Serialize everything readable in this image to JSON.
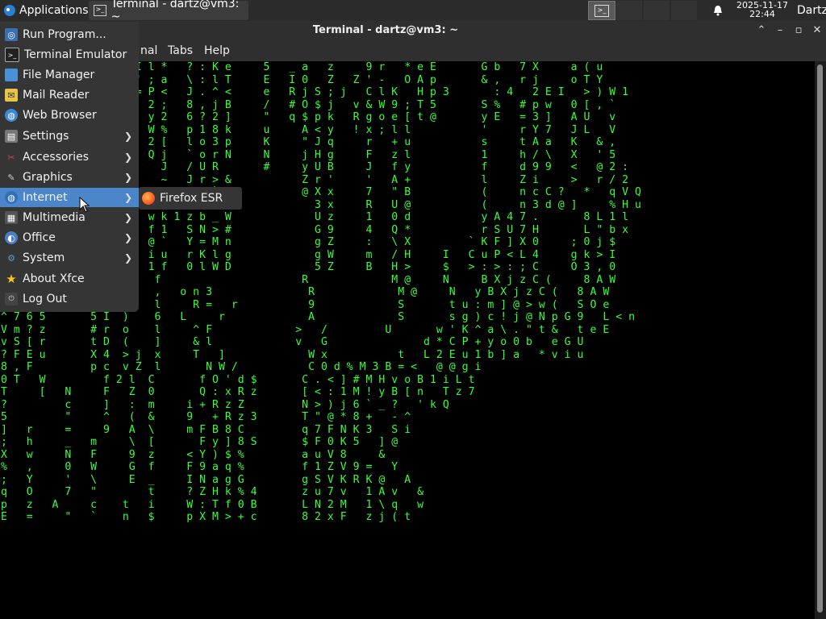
{
  "panel": {
    "applications_label": "Applications",
    "task_label": "Terminal - dartz@vm3: ~",
    "clock_date": "2025-11-17",
    "clock_time": "22:44",
    "user": "Dartz"
  },
  "window": {
    "title": "Terminal - dartz@vm3: ~",
    "menu": [
      "nal",
      "Tabs",
      "Help"
    ]
  },
  "apps_menu": {
    "items": [
      {
        "label": "Run Program...",
        "icon": "run-icon",
        "submenu": false
      },
      {
        "label": "Terminal Emulator",
        "icon": "terminal-icon",
        "submenu": false
      },
      {
        "label": "File Manager",
        "icon": "folder-icon",
        "submenu": false
      },
      {
        "label": "Mail Reader",
        "icon": "mail-icon",
        "submenu": false
      },
      {
        "label": "Web Browser",
        "icon": "globe-icon",
        "submenu": false
      },
      {
        "label": "Settings",
        "icon": "settings-icon",
        "submenu": true
      },
      {
        "label": "Accessories",
        "icon": "accessories-icon",
        "submenu": true
      },
      {
        "label": "Graphics",
        "icon": "graphics-icon",
        "submenu": true
      },
      {
        "label": "Internet",
        "icon": "internet-icon",
        "submenu": true,
        "active": true
      },
      {
        "label": "Multimedia",
        "icon": "multimedia-icon",
        "submenu": true
      },
      {
        "label": "Office",
        "icon": "office-icon",
        "submenu": true
      },
      {
        "label": "System",
        "icon": "system-icon",
        "submenu": true
      },
      {
        "label": "About Xfce",
        "icon": "star-icon",
        "submenu": false
      },
      {
        "label": "Log Out",
        "icon": "logout-icon",
        "submenu": false
      }
    ]
  },
  "internet_submenu": {
    "items": [
      {
        "label": "Firefox ESR",
        "icon": "firefox-icon"
      }
    ]
  },
  "terminal": {
    "lines": [
      "               &     I l *   ? : K e     5   _ a   z     9 r   * e E       G b   7 X     a ( u",
      "               i     ' ; a   \\ : l T     E   I 0   Z   Z ' -   O A p       & ,   r j     o T Y",
      "               O     = P <   J . ^ <     e   R j S ; j   C l K   H p 3       : 4   2 E I   > ) W 1",
      "               p       2 ;   8 , j B     /   # O $ j   v & W 9 ; T 5       S %   # p w   0 [ , `",
      "               \"       y 2   6 ? 2 ]     \"   q $ p k   R g o e [ t @       y E   = 3 ]   A U   v",
      "               k       W %   p 1 8 k     u     A < y   ! x ; l l           '     r Y 7   J L   V",
      "               Z       2 [   l o 3 p     K     \" J q     r   + u           s     t A a   K   & ,",
      "               ^       Q j   ` o r N     N     j H g     F   z l           1     h / \\   X   ' 5",
      "                         J   / U R       #     y U B     J   f y           f     d 9 9   <   @ 2 :",
      "                         ~   J r > &           Z r '     '   A +           l     Z i     >   r / 2",
      "               @ f     e N T 9 . `             @ X x     7   \" B           (     n c C ?   *   q V Q",
      "               S M     n < d m P : +             3 x     R   U @           (     n 3 d @ ]     % H u",
      "               R q     w k 1 z b _ W             U z     1   0 d           y A 4 7 .       8 L 1 l",
      "               `   O   f 1   S N > #             G 9     4   Q *           r S U 7 H       L \" b x",
      "                   2   @ `   Y = M n             g Z     :   \\ X         ` K F ] X 0     ; 0 j $",
      "               _ B     i u   r K l g             g W     m   / H     I   C u P < L 4     g k > I",
      "                   T   1 f   0 l W D             5 Z     B   H >     $   > : > : ; C     O 3 , 0",
      "  g d         < ,  S    f                      R             M @     N     B X j z C (     8 A W",
      "  i G J       j    1    ,   o n 3               R             M @     N   y B X j z C (   8 A W",
      "  G \\ j       c    (    l     R =   r           9             S       t u : m ] @ > w (   S O e",
      "^ 7 6 5       5 I  )    6   L     r             A             S       s g ) c ! j @ N p G 9   L < n",
      "V m ? z       # r  o    l     ^ F             >   /         U       w ' K ^ a \\ . \" t &   t e E",
      "v S [ r       t D  (    ]     & l             v   G               d * C P + y o 0 b   e G U",
      "? F E u       X 4  > j  x     T   ]             W x           t   L 2 E u 1 b ] a   * v i u",
      "8 , F         p c  v Z  l       N W /           C 0 d % M 3 B = <   @ @ g i",
      "0 T   W         f 2 l  C       f O ' d $       C . < ] # M H v o B 1 i L t",
      "T     [   N     F   Z  0       Q : x R z       [ < : 1 M ! y B [ n   T z 7",
      "?         c     ]   :  m     i + R z Z         N > ) j 6 ` _ ?   ' k Q",
      "5         \"     ^   (  &     9   + R z 3       T \" @ * 8 +   - ^",
      "]   r     =     9   A  \\     m F B 8 C         q 7 F N K 3   S i",
      ";   h     _   m     \\  [       F y ] 8 S       $ F 0 K 5   ] @",
      "X   w     N   F     9  z     < Y ) $ %         a u V 8     &",
      "%   ,     0   W     G  f     F 9 a q %         f 1 Z V 9 =   Y",
      ";   Y     '   \\     E  _     I N a g G         g S V K R K @   A",
      "q   O     7   \"        t     ? Z H k % 4       z u 7 v   1 A v   &",
      "p   z   A     c    t   i     W : T f 0 B       L N 2 M   1 \\ q   w",
      "E   =     \"   `    n   $     p X M > + c       8 2 x F   z j ( t"
    ]
  }
}
